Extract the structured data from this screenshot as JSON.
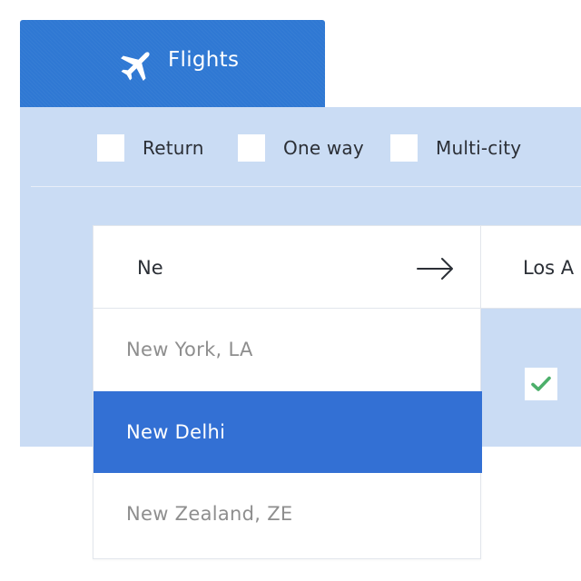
{
  "tab": {
    "label": "Flights",
    "icon": "airplane-icon"
  },
  "trip_types": [
    {
      "label": "Return"
    },
    {
      "label": "One way"
    },
    {
      "label": "Multi-city"
    }
  ],
  "search": {
    "from_value": "Ne",
    "to_value": "Los A",
    "arrow_icon": "arrow-right-icon"
  },
  "suggestions": [
    {
      "label": "New York, LA",
      "selected": false
    },
    {
      "label": "New Delhi",
      "selected": true
    },
    {
      "label": "New Zealand, ZE",
      "selected": false
    }
  ],
  "options": {
    "checked": true,
    "check_icon": "checkmark-icon"
  },
  "colors": {
    "tab_bg": "#2f78d3",
    "panel_bg": "#cadcf4",
    "selected_bg": "#3370d4",
    "check_green": "#4caf6a"
  }
}
